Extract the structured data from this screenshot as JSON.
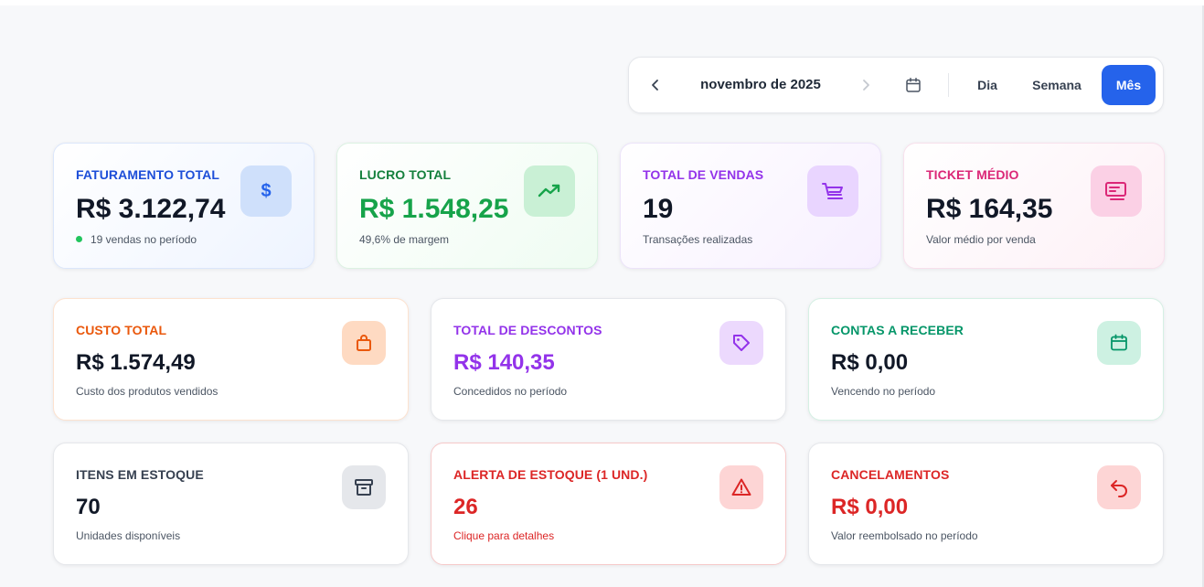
{
  "date_nav": {
    "period_label": "novembro de 2025",
    "views": {
      "day": "Dia",
      "week": "Semana",
      "month": "Mês"
    },
    "active_view": "Mês"
  },
  "colors": {
    "primary": "#2563eb",
    "blue": "#1d4ed8",
    "green": "#16a34a",
    "purple": "#9333ea",
    "pink": "#db2777",
    "orange": "#ea580c",
    "teal": "#059669",
    "gray": "#4b5563",
    "red": "#dc2626"
  },
  "cards": {
    "revenue": {
      "label": "FATURAMENTO TOTAL",
      "value": "R$ 3.122,74",
      "sub": "19 vendas no período",
      "icon": "dollar-icon"
    },
    "profit": {
      "label": "LUCRO TOTAL",
      "value": "R$ 1.548,25",
      "sub": "49,6% de margem",
      "icon": "trending-up-icon"
    },
    "sales": {
      "label": "TOTAL DE VENDAS",
      "value": "19",
      "sub": "Transações realizadas",
      "icon": "cart-icon"
    },
    "ticket": {
      "label": "TICKET MÉDIO",
      "value": "R$ 164,35",
      "sub": "Valor médio por venda",
      "icon": "receipt-icon"
    },
    "cost": {
      "label": "CUSTO TOTAL",
      "value": "R$ 1.574,49",
      "sub": "Custo dos produtos vendidos",
      "icon": "shopping-bag-icon"
    },
    "discounts": {
      "label": "TOTAL DE DESCONTOS",
      "value": "R$ 140,35",
      "sub": "Concedidos no período",
      "icon": "tag-icon"
    },
    "receivables": {
      "label": "CONTAS A RECEBER",
      "value": "R$ 0,00",
      "sub": "Vencendo no período",
      "icon": "calendar-icon"
    },
    "stock": {
      "label": "ITENS EM ESTOQUE",
      "value": "70",
      "sub": "Unidades disponíveis",
      "icon": "archive-icon"
    },
    "stock_alert": {
      "label": "ALERTA DE ESTOQUE (1 UND.)",
      "value": "26",
      "sub": "Clique para detalhes",
      "icon": "warning-icon"
    },
    "cancellations": {
      "label": "CANCELAMENTOS",
      "value": "R$ 0,00",
      "sub": "Valor reembolsado no período",
      "icon": "undo-icon"
    }
  }
}
